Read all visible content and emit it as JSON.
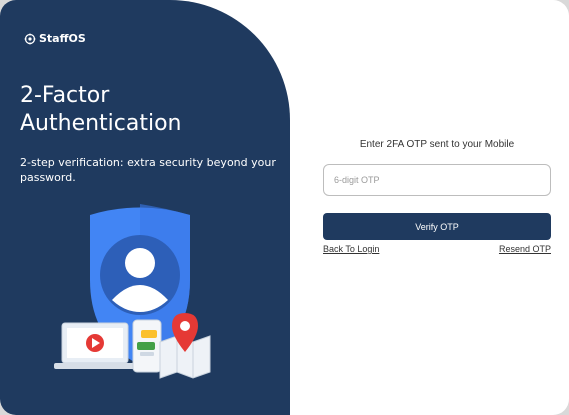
{
  "brand": {
    "name": "StaffOS",
    "logo_icon": "staffos-logo-icon"
  },
  "hero": {
    "title": "2-Factor Authentication",
    "subtitle": "2-step verification: extra security beyond your password.",
    "illustration": "security-shield-user-illustration"
  },
  "form": {
    "title": "Enter 2FA OTP sent to your Mobile",
    "otp_value": "",
    "otp_placeholder": "6-digit OTP",
    "verify_label": "Verify OTP",
    "back_label": "Back To Login",
    "resend_label": "Resend OTP"
  },
  "colors": {
    "primary": "#1f3a5f",
    "shield": "#4285f4",
    "shield_inner": "#2f6fd6",
    "accent_red": "#e53935",
    "accent_yellow": "#fbc02d",
    "accent_green": "#43a047"
  }
}
